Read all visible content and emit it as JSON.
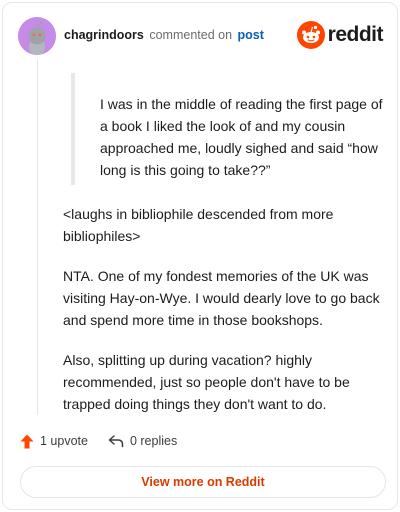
{
  "header": {
    "username": "chagrindoors",
    "action_text": "commented on",
    "target_text": "post",
    "brand_wordmark": "reddit"
  },
  "comment": {
    "quote": "I was in the middle of reading the first page of a book I liked the look of and my cousin approached me, loudly sighed and said “how long is this going to take??”",
    "paragraphs": [
      "<laughs in bibliophile descended from more bibliophiles>",
      "NTA. One of my fondest memories of the UK was visiting Hay-on-Wye. I would dearly love to go back and spend more time in those bookshops.",
      "Also, splitting up during vacation? highly recommended, just so people don't have to be trapped doing things they don't want to do."
    ]
  },
  "actions": {
    "upvote_label": "1 upvote",
    "reply_label": "0 replies"
  },
  "footer": {
    "view_more_label": "View more on Reddit"
  },
  "colors": {
    "upvote": "#ff4500",
    "link": "#0a5fb8",
    "view_more": "#d93a00",
    "avatar_bg": "#c58be6"
  },
  "icons": {
    "avatar": "snoo-avatar-icon",
    "brand": "reddit-logo-icon",
    "upvote": "upvote-arrow-icon",
    "reply": "reply-arrow-icon"
  }
}
